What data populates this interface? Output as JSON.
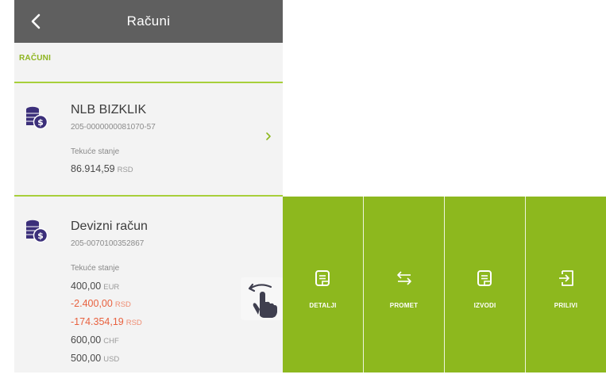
{
  "header": {
    "title": "Računi"
  },
  "section": {
    "label": "RAČUNI"
  },
  "accounts": [
    {
      "name": "NLB BIZKLIK",
      "number": "205-0000000081070-57",
      "balance_label": "Tekuće stanje",
      "balances": [
        {
          "amount": "86.914,59",
          "currency": "RSD"
        }
      ]
    },
    {
      "name": "Devizni račun",
      "number": "205-0070100352867",
      "balance_label": "Tekuće stanje",
      "balances": [
        {
          "amount": "400,00",
          "currency": "EUR"
        },
        {
          "amount": "-2.400,00",
          "currency": "RSD"
        },
        {
          "amount": "-174.354,19",
          "currency": "RSD"
        },
        {
          "amount": "600,00",
          "currency": "CHF"
        },
        {
          "amount": "500,00",
          "currency": "USD"
        }
      ]
    }
  ],
  "actions": [
    {
      "label": "DETALJI",
      "icon": "document-icon"
    },
    {
      "label": "PROMET",
      "icon": "transfer-arrows-icon"
    },
    {
      "label": "IZVODI",
      "icon": "statement-icon"
    },
    {
      "label": "PRILIVI",
      "icon": "incoming-icon"
    }
  ],
  "colors": {
    "header_bg": "#5f5f5f",
    "accent_green": "#8db81e",
    "negative": "#e8613f",
    "coin_purple": "#3b2f7a"
  }
}
